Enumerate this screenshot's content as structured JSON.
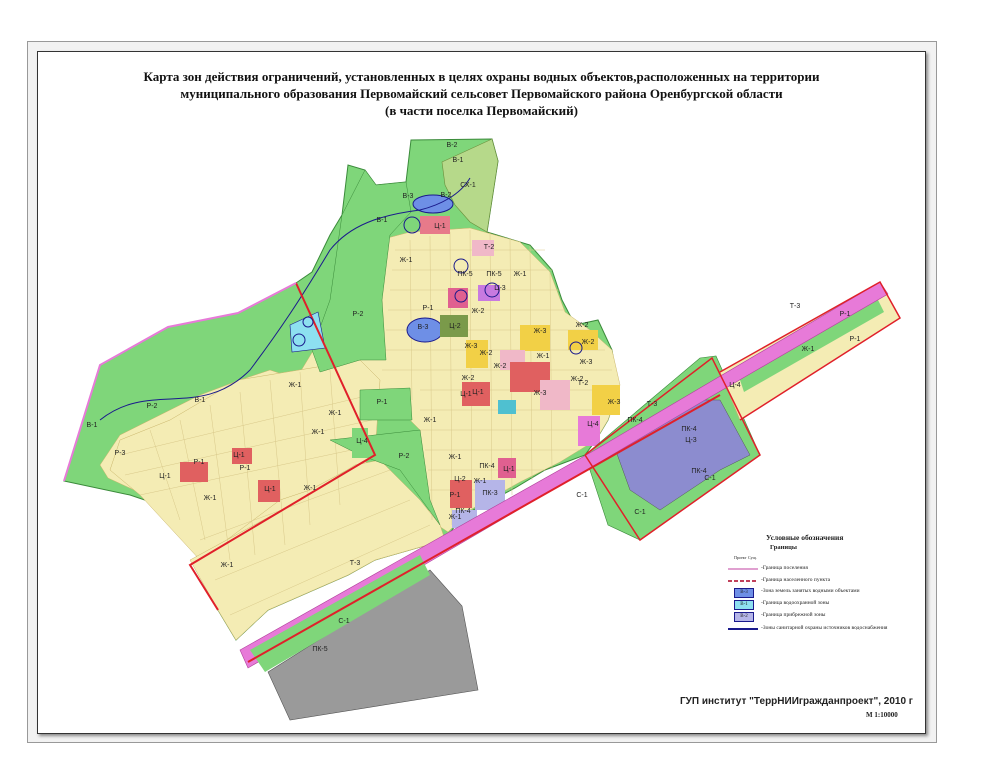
{
  "title": {
    "line1": "Карта зон действия ограничений,  установленных в целях охраны водных объектов,расположенных на территории",
    "line2": "муниципального образования Первомайский сельсовет Первомайского района Оренбургской области",
    "line3": "(в части поселка Первомайский)"
  },
  "legend": {
    "heading": "Условные обозначения",
    "subheading": "Границы",
    "items": [
      {
        "text": "-Граница поселения",
        "color": "#e0a0d0"
      },
      {
        "text": "-Граница населенного пункта",
        "color": "#c0405a"
      },
      {
        "text": "-Зона земель занятых водными объектами",
        "code": "В-3",
        "color": "#6e8fe6"
      },
      {
        "text": "-Граница водоохранной зоны",
        "code": "В-1",
        "color": "#8de0f0"
      },
      {
        "text": "-Граница прибрежной зоны",
        "code": "В-2",
        "color": "#b5b5e8"
      },
      {
        "text": "-Зоны санитарной охраны источников водоснабжения",
        "color": "#1a1a8c"
      }
    ],
    "swatch_mini_labels": [
      "Проект",
      "Сущ."
    ]
  },
  "footer": "ГУП институт \"ТеррНИИгражданпроект\", 2010 г",
  "scale": "М 1:10000",
  "zone_labels": [
    "В-2",
    "В-1",
    "В-3",
    "В-2",
    "СХ-1",
    "В-1",
    "Ц-1",
    "Т-2",
    "Ж-1",
    "ПК-5",
    "ПК-5",
    "Ж-1",
    "Ц-3",
    "Р-2",
    "Р-1",
    "В-3",
    "Ж-2",
    "Ц-2",
    "Ж-2",
    "Ж-3",
    "Ж-3",
    "Ж-2",
    "Ж-2",
    "Ж-2",
    "Ж-1",
    "Ж-3",
    "Ж-2",
    "Ж-2",
    "Ж-1",
    "Ц-1",
    "Ц-1",
    "Ж-3",
    "Ж-3",
    "Т-2",
    "Ц-4",
    "Ж-1",
    "В-1",
    "Р-1",
    "В-1",
    "Р-2",
    "Ж-1",
    "Ж-1",
    "Ц-4",
    "Р-2",
    "Р-3",
    "Р-1",
    "Ц-1",
    "Р-1",
    "Ц-1",
    "Ц-1",
    "Ж-1",
    "Ж-1",
    "Ж-1",
    "Ж-1",
    "Ж-1",
    "Р-1",
    "ПК-4",
    "Ц-2",
    "Ж-1",
    "Ц-1",
    "ПК-3",
    "ПК-4",
    "Т-3",
    "С-1",
    "ПК-5",
    "Т-3",
    "С-1",
    "Р-1",
    "Р-1",
    "Ж-1",
    "Ц-4",
    "Т-3",
    "ПК-4",
    "ПК-4",
    "Ц-3",
    "ПК-4",
    "С-1",
    "С-1"
  ]
}
